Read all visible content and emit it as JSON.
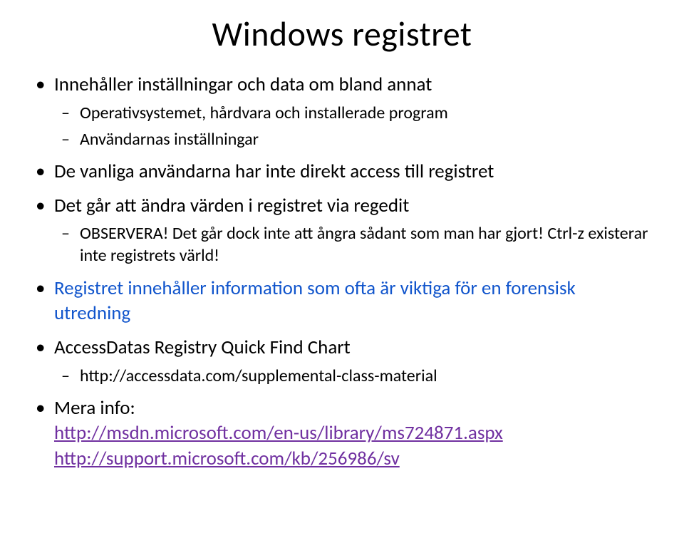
{
  "title": "Windows registret",
  "bullets": {
    "b1": {
      "text": "Innehåller inställningar och data om bland annat",
      "sub": {
        "s1": "Operativsystemet, hårdvara och installerade program",
        "s2": "Användarnas inställningar"
      }
    },
    "b2": {
      "text": "De vanliga användarna har inte direkt access till registret"
    },
    "b3": {
      "text": "Det går att ändra värden i registret via regedit",
      "sub": {
        "s1": "OBSERVERA! Det går dock inte att ångra sådant som man har gjort! Ctrl-z existerar inte registrets värld!"
      }
    },
    "b4": {
      "text": "Registret innehåller information som ofta är viktiga för en forensisk utredning"
    },
    "b5": {
      "text": "AccessDatas Registry Quick Find Chart",
      "sub": {
        "s1": "http://accessdata.com/supplemental-class-material"
      }
    },
    "b6": {
      "text": "Mera info:",
      "link1": "http://msdn.microsoft.com/en-us/library/ms724871.aspx",
      "link2": "http://support.microsoft.com/kb/256986/sv"
    }
  }
}
